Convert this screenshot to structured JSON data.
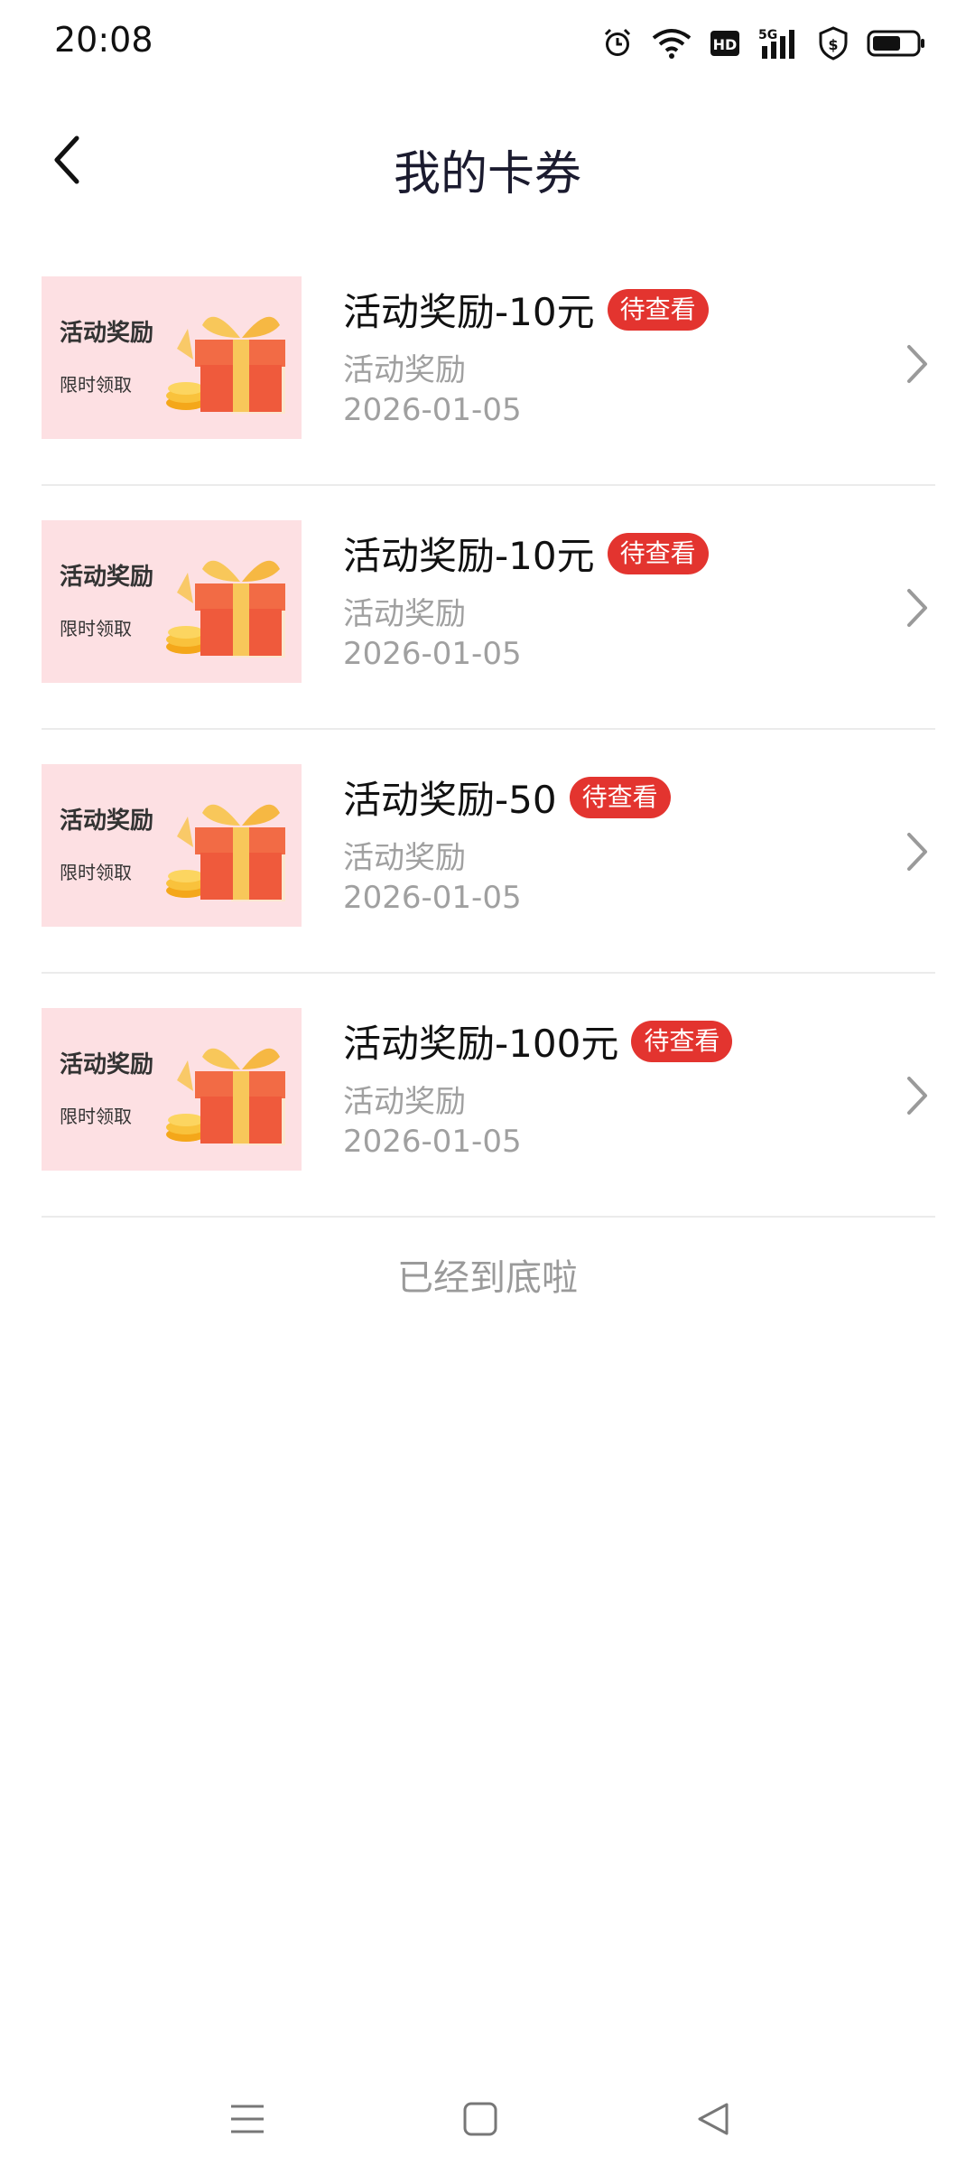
{
  "status_bar": {
    "time": "20:08",
    "icons": [
      "alarm-icon",
      "wifi-icon",
      "hd-icon",
      "signal-5g-icon",
      "shield-dollar-icon",
      "battery-icon"
    ]
  },
  "nav": {
    "title": "我的卡券",
    "back_icon": "chevron-left-icon"
  },
  "coupons": [
    {
      "title": "活动奖励-10元",
      "badge": "待查看",
      "subtitle": "活动奖励",
      "date": "2026-01-05",
      "thumb_title": "活动奖励",
      "thumb_sub": "限时领取"
    },
    {
      "title": "活动奖励-10元",
      "badge": "待查看",
      "subtitle": "活动奖励",
      "date": "2026-01-05",
      "thumb_title": "活动奖励",
      "thumb_sub": "限时领取"
    },
    {
      "title": "活动奖励-50",
      "badge": "待查看",
      "subtitle": "活动奖励",
      "date": "2026-01-05",
      "thumb_title": "活动奖励",
      "thumb_sub": "限时领取"
    },
    {
      "title": "活动奖励-100元",
      "badge": "待查看",
      "subtitle": "活动奖励",
      "date": "2026-01-05",
      "thumb_title": "活动奖励",
      "thumb_sub": "限时领取"
    }
  ],
  "footer": {
    "end_text": "已经到底啦"
  },
  "system_nav": {
    "icons": [
      "menu-icon",
      "home-square-icon",
      "back-triangle-icon"
    ]
  },
  "colors": {
    "badge": "#e3342f",
    "thumb_bg": "#fde0e3",
    "muted_text": "#a0a0a0",
    "title_text": "#1b1b2f"
  }
}
